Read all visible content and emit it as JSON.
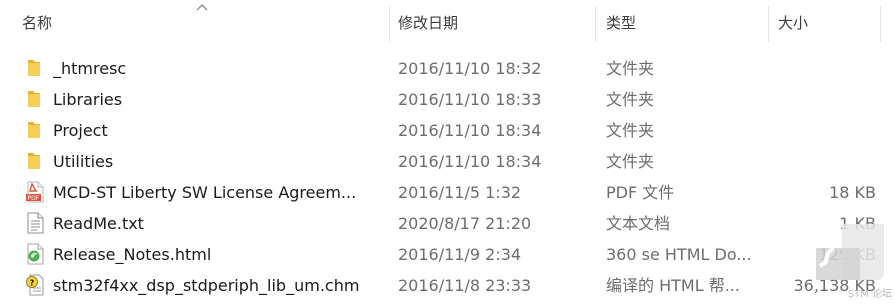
{
  "columns": {
    "name": "名称",
    "date": "修改日期",
    "type": "类型",
    "size": "大小"
  },
  "files": [
    {
      "name": "_htmresc",
      "date": "2016/11/10 18:32",
      "type": "文件夹",
      "size": "",
      "icon": "folder-icon"
    },
    {
      "name": "Libraries",
      "date": "2016/11/10 18:33",
      "type": "文件夹",
      "size": "",
      "icon": "folder-icon"
    },
    {
      "name": "Project",
      "date": "2016/11/10 18:34",
      "type": "文件夹",
      "size": "",
      "icon": "folder-icon"
    },
    {
      "name": "Utilities",
      "date": "2016/11/10 18:34",
      "type": "文件夹",
      "size": "",
      "icon": "folder-icon"
    },
    {
      "name": "MCD-ST Liberty SW License Agreem...",
      "date": "2016/11/5 1:32",
      "type": "PDF 文件",
      "size": "18 KB",
      "icon": "pdf-file-icon"
    },
    {
      "name": "ReadMe.txt",
      "date": "2020/8/17 21:20",
      "type": "文本文档",
      "size": "1 KB",
      "icon": "text-file-icon"
    },
    {
      "name": "Release_Notes.html",
      "date": "2016/11/9 2:34",
      "type": "360 se HTML Do...",
      "size": "129 KB",
      "icon": "html-file-icon"
    },
    {
      "name": "stm32f4xx_dsp_stdperiph_lib_um.chm",
      "date": "2016/11/8 23:33",
      "type": "编译的 HTML 帮...",
      "size": "36,138 KB",
      "icon": "chm-help-file-icon"
    }
  ],
  "watermark": {
    "text": "STM 论坛"
  },
  "colors": {
    "folder": "#f0c03a",
    "pdf": "#e2553b",
    "html": "#4caf50",
    "chm": "#d4b21c"
  }
}
